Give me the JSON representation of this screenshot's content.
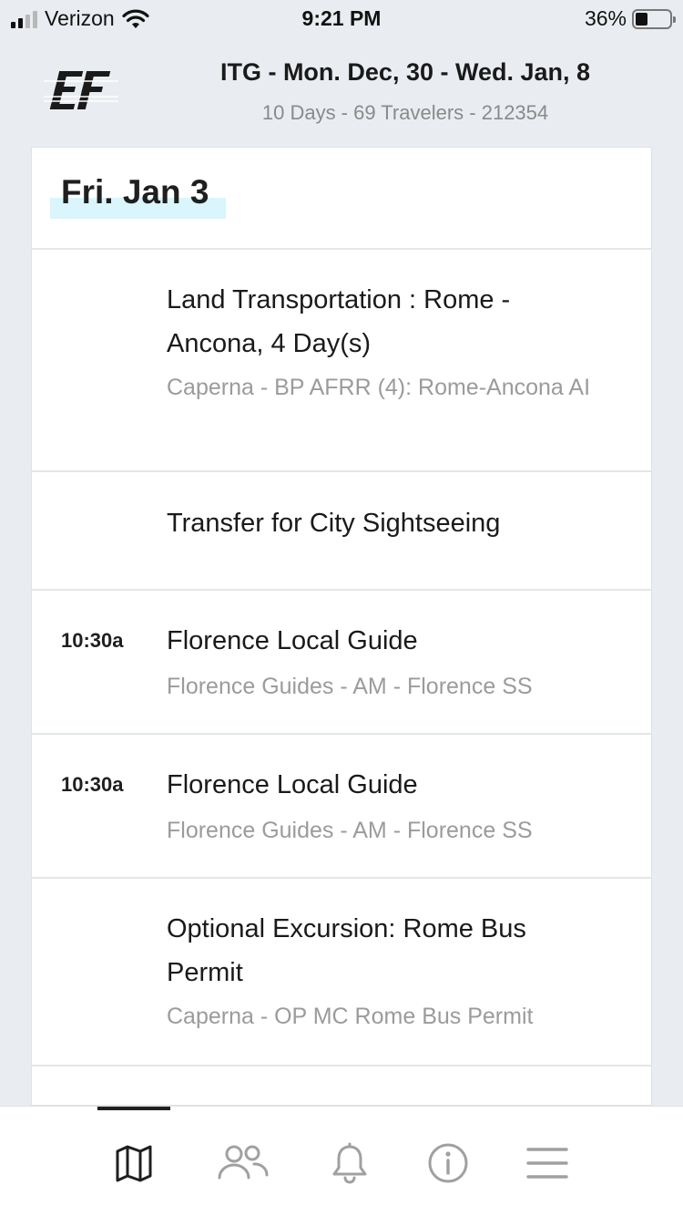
{
  "status": {
    "carrier": "Verizon",
    "time": "9:21 PM",
    "battery_text": "36%",
    "battery_level": 0.36
  },
  "header": {
    "logo": "EF",
    "title": "ITG - Mon. Dec, 30 - Wed. Jan, 8",
    "subtitle": "10 Days - 69 Travelers - 212354"
  },
  "day": {
    "title": "Fri. Jan 3",
    "items": [
      {
        "time": "",
        "title": "Land Transportation : Rome - Ancona, 4 Day(s)",
        "subtitle": "Caperna - BP AFRR (4): Rome-Ancona AI"
      },
      {
        "time": "",
        "title": "Transfer for City Sightseeing",
        "subtitle": ""
      },
      {
        "time": "10:30a",
        "title": "Florence Local Guide",
        "subtitle": "Florence Guides - AM - Florence SS"
      },
      {
        "time": "10:30a",
        "title": "Florence Local Guide",
        "subtitle": "Florence Guides - AM - Florence SS"
      },
      {
        "time": "",
        "title": "Optional Excursion: Rome Bus Permit",
        "subtitle": "Caperna - OP MC Rome Bus Permit"
      }
    ]
  },
  "tabbar": {
    "tabs": [
      {
        "icon": "map-icon",
        "active": true
      },
      {
        "icon": "people-icon",
        "active": false
      },
      {
        "icon": "bell-icon",
        "active": false
      },
      {
        "icon": "info-icon",
        "active": false
      },
      {
        "icon": "menu-icon",
        "active": false
      }
    ]
  },
  "colors": {
    "background": "#e9edf1",
    "highlight": "#daf5fb",
    "active_icon": "#1f1f1f",
    "inactive_icon": "#a0a0a0",
    "muted_text": "#9b9b9b"
  }
}
